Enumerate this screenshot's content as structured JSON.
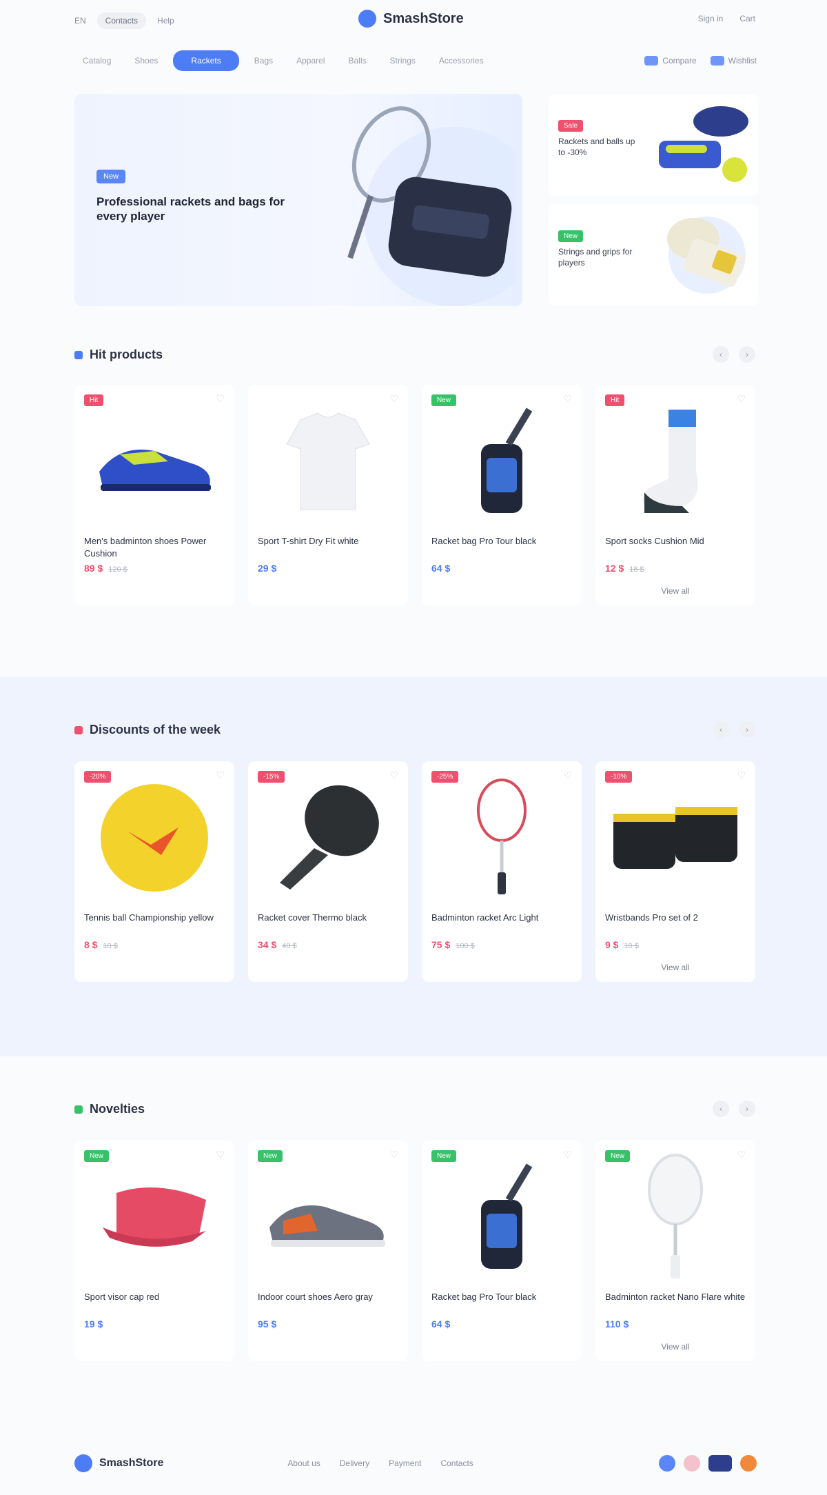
{
  "header": {
    "left_links": [
      "EN",
      "Contacts",
      "Help"
    ],
    "brand": "SmashStore",
    "right_links": [
      "Sign in",
      "Cart"
    ]
  },
  "nav": {
    "items": [
      "Catalog",
      "Shoes",
      "Rackets",
      "Bags",
      "Apparel",
      "Balls",
      "Strings",
      "Accessories"
    ],
    "active_index": 2,
    "right": [
      "Compare",
      "Wishlist"
    ]
  },
  "hero": {
    "tag": "New",
    "title": "Professional rackets and bags for every player",
    "side_cards": [
      {
        "tag": "Sale",
        "tag_color": "#f0506e",
        "text": "Rackets and balls up to -30%"
      },
      {
        "tag": "New",
        "tag_color": "#37c26a",
        "text": "Strings and grips for players"
      }
    ]
  },
  "sections": [
    {
      "title": "Hit products",
      "accent": "#4d7cf7",
      "more": "View all",
      "products": [
        {
          "badge": "Hit",
          "badge_color": "#f0506e",
          "image": "shoe-blue-icon",
          "name": "Men's badminton shoes Power Cushion",
          "price": "89 $",
          "old": "120 $",
          "price_color": "#f0506e"
        },
        {
          "badge": "",
          "badge_color": "",
          "image": "tshirt-icon",
          "name": "Sport T-shirt Dry Fit white",
          "price": "29 $",
          "old": "",
          "price_color": "#4d7cf7"
        },
        {
          "badge": "New",
          "badge_color": "#37c26a",
          "image": "racket-bag-icon",
          "name": "Racket bag Pro Tour black",
          "price": "64 $",
          "old": "",
          "price_color": "#4d7cf7"
        },
        {
          "badge": "Hit",
          "badge_color": "#f0506e",
          "image": "sock-icon",
          "name": "Sport socks Cushion Mid",
          "price": "12 $",
          "old": "18 $",
          "price_color": "#f0506e"
        }
      ]
    },
    {
      "title": "Discounts of the week",
      "accent": "#f0506e",
      "more": "View all",
      "products": [
        {
          "badge": "-20%",
          "badge_color": "#f0506e",
          "image": "ball-icon",
          "name": "Tennis ball Championship yellow",
          "price": "8 $",
          "old": "10 $",
          "price_color": "#f0506e"
        },
        {
          "badge": "-15%",
          "badge_color": "#f0506e",
          "image": "racket-cover-icon",
          "name": "Racket cover Thermo black",
          "price": "34 $",
          "old": "40 $",
          "price_color": "#f0506e"
        },
        {
          "badge": "-25%",
          "badge_color": "#f0506e",
          "image": "racket-icon",
          "name": "Badminton racket Arc Light",
          "price": "75 $",
          "old": "100 $",
          "price_color": "#f0506e"
        },
        {
          "badge": "-10%",
          "badge_color": "#f0506e",
          "image": "wristband-icon",
          "name": "Wristbands Pro set of 2",
          "price": "9 $",
          "old": "10 $",
          "price_color": "#f0506e"
        }
      ]
    },
    {
      "title": "Novelties",
      "accent": "#37c26a",
      "more": "View all",
      "products": [
        {
          "badge": "New",
          "badge_color": "#37c26a",
          "image": "cap-icon",
          "name": "Sport visor cap red",
          "price": "19 $",
          "old": "",
          "price_color": "#4d7cf7"
        },
        {
          "badge": "New",
          "badge_color": "#37c26a",
          "image": "shoe-gray-icon",
          "name": "Indoor court shoes Aero gray",
          "price": "95 $",
          "old": "",
          "price_color": "#4d7cf7"
        },
        {
          "badge": "New",
          "badge_color": "#37c26a",
          "image": "racket-bag-icon",
          "name": "Racket bag Pro Tour black",
          "price": "64 $",
          "old": "",
          "price_color": "#4d7cf7"
        },
        {
          "badge": "New",
          "badge_color": "#37c26a",
          "image": "racket-white-icon",
          "name": "Badminton racket Nano Flare white",
          "price": "110 $",
          "old": "",
          "price_color": "#4d7cf7"
        }
      ]
    }
  ],
  "footer": {
    "brand": "SmashStore",
    "links": [
      "About us",
      "Delivery",
      "Payment",
      "Contacts"
    ]
  }
}
